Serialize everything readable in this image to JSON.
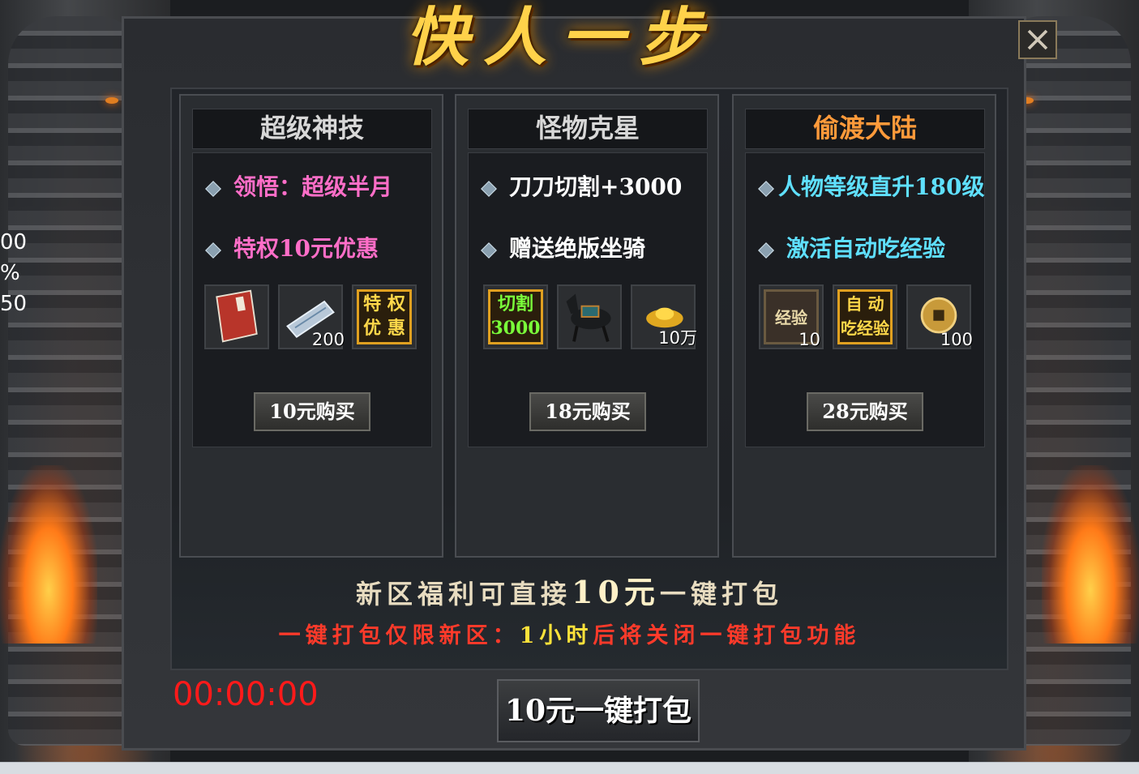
{
  "title": "快人一步",
  "close_icon": "close-icon",
  "left_strip": [
    "00",
    "%",
    "50"
  ],
  "panels": [
    {
      "name": "超级神技",
      "name_color": "#d8d8d8",
      "feature1": "领悟：超级半月",
      "feature2": "特权10元优惠",
      "feature_color": "#ff6ec8",
      "items": [
        {
          "icon": "book-icon",
          "qty": ""
        },
        {
          "icon": "scroll-icon",
          "qty": "200"
        },
        {
          "icon": "privilege-icon",
          "label": "特 权 优 惠",
          "qty": ""
        }
      ],
      "buy_label": "10元购买"
    },
    {
      "name": "怪物克星",
      "name_color": "#d8d8d8",
      "feature1": "刀刀切割+3000",
      "feature2": "赠送绝版坐骑",
      "feature_color": "#ffffff",
      "items": [
        {
          "icon": "cut-icon",
          "label": "切割 3000",
          "qty": ""
        },
        {
          "icon": "horse-icon",
          "qty": ""
        },
        {
          "icon": "gold-ingot-icon",
          "qty": "10万"
        }
      ],
      "buy_label": "18元购买"
    },
    {
      "name": "偷渡大陆",
      "name_color": "#ff9a3a",
      "feature1": "人物等级直升180级",
      "feature2": "激活自动吃经验",
      "feature_color": "#5fe0ff",
      "items": [
        {
          "icon": "exp-icon",
          "label": "经验",
          "qty": "10"
        },
        {
          "icon": "auto-exp-icon",
          "label": "自 动 吃经验",
          "qty": ""
        },
        {
          "icon": "coin-icon",
          "qty": "100"
        }
      ],
      "buy_label": "28元购买"
    }
  ],
  "promo_line1_a": "新区福利可直接",
  "promo_line1_hl": "10元",
  "promo_line1_b": "一键打包",
  "promo_line2_a": "一键打包仅限新区：",
  "promo_line2_hl": "1小时",
  "promo_line2_b": "后将关闭一键打包功能",
  "timer": "00:00:00",
  "pack_button": "10元一键打包"
}
